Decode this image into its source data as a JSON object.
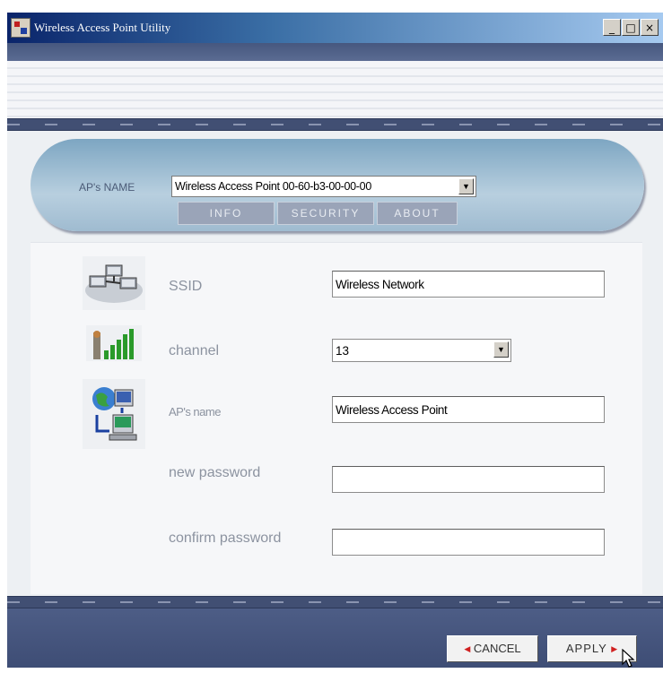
{
  "window": {
    "title": "Wireless Access Point Utility",
    "minimize_label": "_",
    "maximize_label": "□",
    "close_label": "×"
  },
  "ap_selector": {
    "label": "AP's NAME",
    "selected": "Wireless Access Point 00-60-b3-00-00-00"
  },
  "tabs": [
    {
      "label": "INFO"
    },
    {
      "label": "SECURITY"
    },
    {
      "label": "ABOUT"
    }
  ],
  "form": {
    "ssid_label": "SSID",
    "ssid_value": "Wireless Network",
    "channel_label": "channel",
    "channel_value": "13",
    "apname_label": "AP's name",
    "apname_value": "Wireless Access Point",
    "new_password_label": "new password",
    "new_password_value": "",
    "confirm_password_label": "confirm password",
    "confirm_password_value": ""
  },
  "buttons": {
    "cancel_label": "CANCEL",
    "apply_label": "APPLY"
  },
  "colors": {
    "title_bar": "#0a246a",
    "frame": "#4a5a84",
    "pill": "#9fbbd0",
    "button_arrow": "#d02020"
  },
  "icons": [
    "app-icon",
    "network-computers-icon",
    "signal-strength-icon",
    "globe-computer-icon",
    "dropdown-arrow-icon",
    "mouse-cursor-icon"
  ]
}
